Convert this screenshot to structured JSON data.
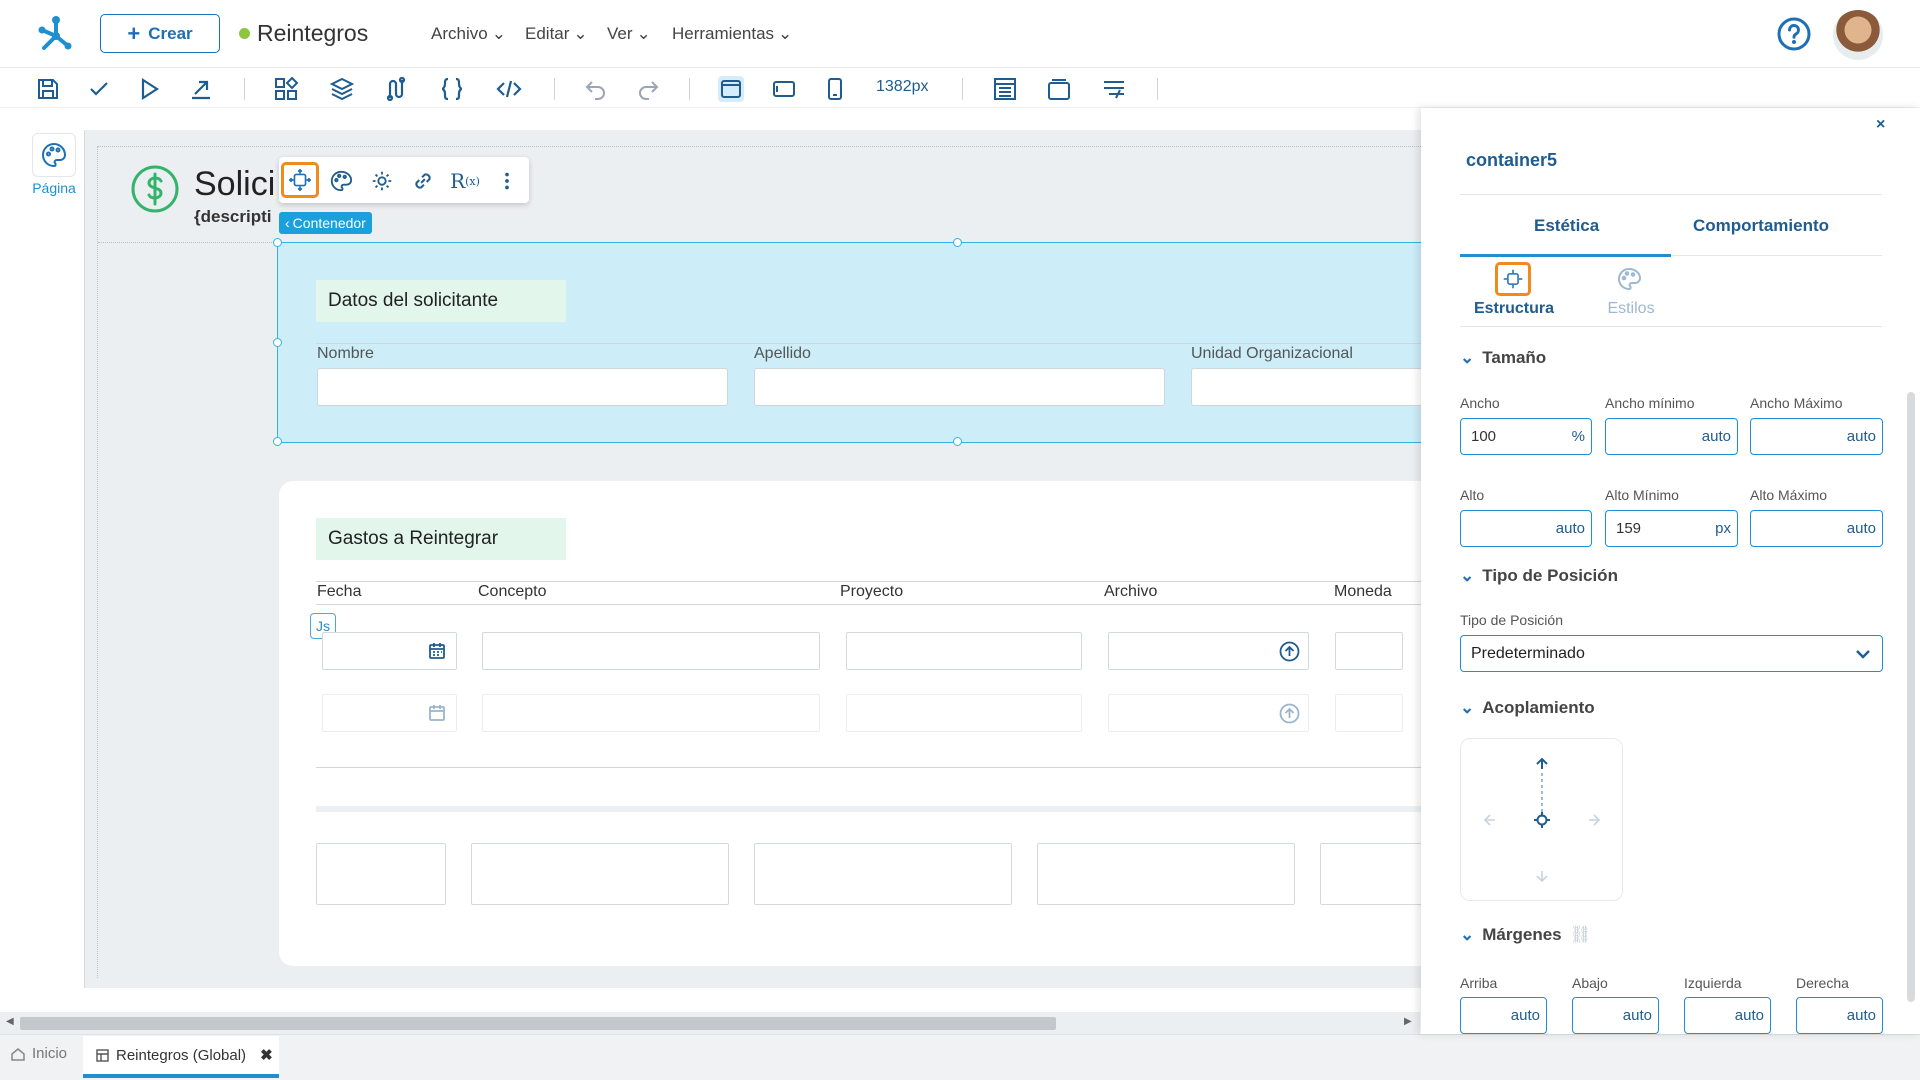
{
  "topbar": {
    "create_label": "Crear",
    "app_name": "Reintegros",
    "menus": [
      "Archivo",
      "Editar",
      "Ver",
      "Herramientas"
    ]
  },
  "toolbar": {
    "width_readout": "1382px"
  },
  "rail": {
    "page_label": "Página"
  },
  "canvas": {
    "page_heading": "Solici",
    "page_desc": "{descripti",
    "container_tag": "Contenedor",
    "section1": {
      "title": "Datos del solicitante",
      "fields": [
        "Nombre",
        "Apellido",
        "Unidad Organizacional"
      ]
    },
    "section2": {
      "title": "Gastos a Reintegrar",
      "columns": [
        "Fecha",
        "Concepto",
        "Proyecto",
        "Archivo",
        "Moneda"
      ],
      "js_badge": "Js"
    }
  },
  "bottom_tabs": {
    "home": "Inicio",
    "doc": "Reintegros (Global)"
  },
  "panel": {
    "close": "×",
    "title": "container5",
    "tabs": [
      "Estética",
      "Comportamiento"
    ],
    "subtabs": [
      "Estructura",
      "Estilos"
    ],
    "size": {
      "group": "Tamaño",
      "width_label": "Ancho",
      "width_value": "100",
      "width_unit": "%",
      "min_width_label": "Ancho mínimo",
      "min_width_value": "auto",
      "max_width_label": "Ancho Máximo",
      "max_width_value": "auto",
      "height_label": "Alto",
      "height_value": "auto",
      "min_height_label": "Alto Mínimo",
      "min_height_value": "159",
      "min_height_unit": "px",
      "max_height_label": "Alto Máximo",
      "max_height_value": "auto"
    },
    "position": {
      "group": "Tipo de Posición",
      "label": "Tipo de Posición",
      "value": "Predeterminado"
    },
    "docking": {
      "group": "Acoplamiento"
    },
    "margins": {
      "group": "Márgenes",
      "top_label": "Arriba",
      "top_value": "auto",
      "bottom_label": "Abajo",
      "bottom_value": "auto",
      "left_label": "Izquierda",
      "left_value": "auto",
      "right_label": "Derecha",
      "right_value": "auto"
    }
  },
  "colors": {
    "accent": "#1f8fd0",
    "primary": "#1f5c8f",
    "highlight": "#f0891e",
    "selection_fill": "#cdeef9",
    "section_title_bg": "#e3f6ec"
  }
}
